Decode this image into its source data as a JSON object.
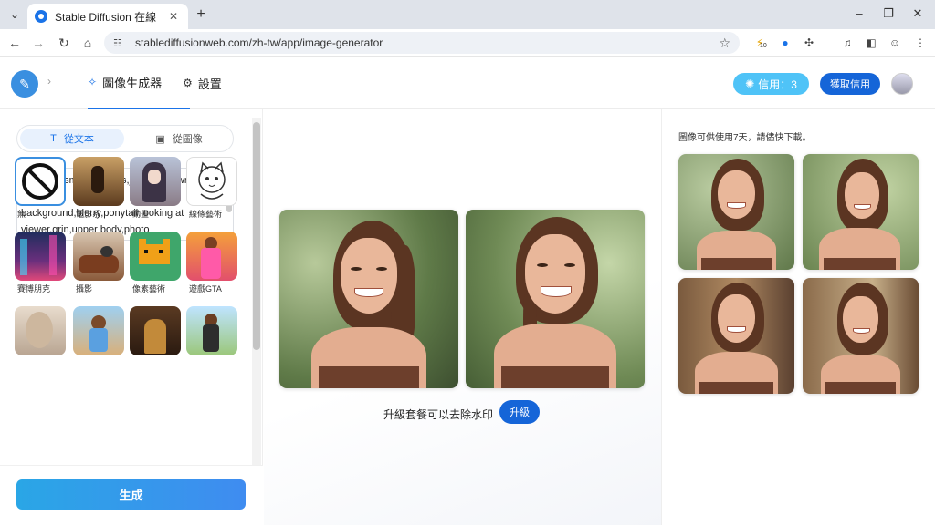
{
  "browser": {
    "tab_title": "Stable Diffusion 在線",
    "url": "stablediffusionweb.com/zh-tw/app/image-generator",
    "new_tab": "+",
    "tab_close": "✕",
    "ext_badge": "10"
  },
  "header": {
    "tabs": [
      {
        "label": "圖像生成器",
        "icon": "magic-wand-icon"
      },
      {
        "label": "設置",
        "icon": "gear-icon"
      }
    ],
    "credits_label": "信用：3",
    "get_credits_label": "獲取信用"
  },
  "left": {
    "mode_tabs": [
      {
        "label": "從文本",
        "icon": "text-icon"
      },
      {
        "label": "從圖像",
        "icon": "image-icon"
      }
    ],
    "prompt": "1girl,solo,smile,earrings,jewelry,brown hair,blurry background,blurry,ponytail,looking at viewer,grin,upper body,photo",
    "style_label": "樣式",
    "style_more": "更多",
    "styles": [
      {
        "label": "無"
      },
      {
        "label": "電影系"
      },
      {
        "label": "動畫"
      },
      {
        "label": "線條藝術"
      },
      {
        "label": "賽博朋克"
      },
      {
        "label": "攝影"
      },
      {
        "label": "像素藝術"
      },
      {
        "label": "遊戲GTA"
      },
      {
        "label": ""
      },
      {
        "label": ""
      },
      {
        "label": ""
      },
      {
        "label": ""
      }
    ],
    "generate_label": "生成"
  },
  "center": {
    "upgrade_text": "升級套餐可以去除水印",
    "upgrade_button": "升級"
  },
  "right": {
    "note": "圖像可供使用7天，請儘快下載。"
  },
  "colors": {
    "accent": "#1a73e8",
    "credit_pill": "#4fc3f7",
    "primary_button": "#1565d8",
    "generate_gradient_start": "#2aa6e6",
    "generate_gradient_end": "#3f8cf0"
  }
}
